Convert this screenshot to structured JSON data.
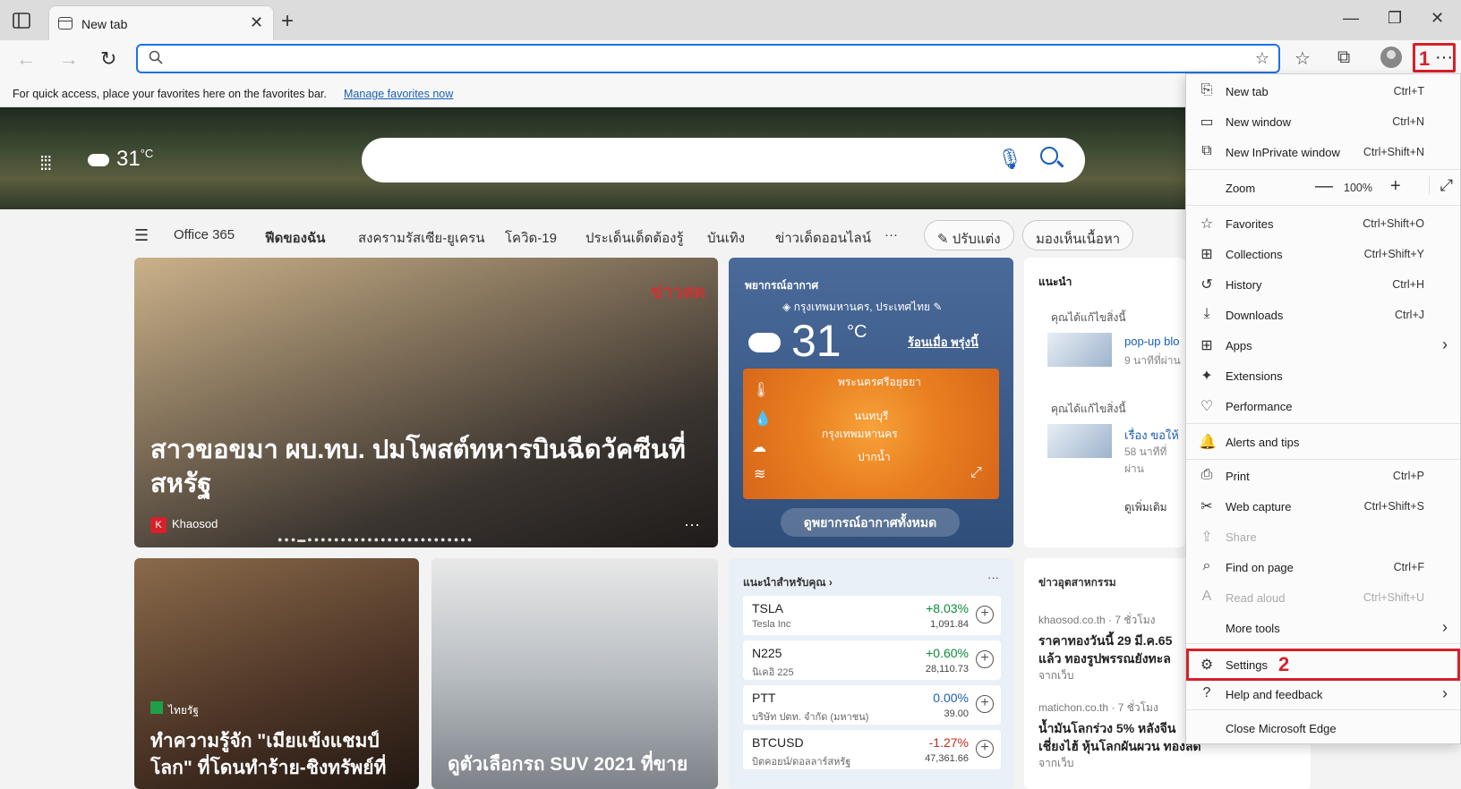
{
  "tab": {
    "title": "New tab"
  },
  "address": {
    "placeholder": ""
  },
  "favorites_bar": {
    "text": "For quick access, place your favorites here on the favorites bar.",
    "link": "Manage favorites now"
  },
  "hero": {
    "temp": "31",
    "unit": "°C"
  },
  "categories": [
    "Office 365",
    "ฟีดของฉัน",
    "สงครามรัสเซีย-ยูเครน",
    "โควิด-19",
    "ประเด็นเด็ดต้องรู้",
    "บันเทิง",
    "ข่าวเด็ดออนไลน์",
    "···"
  ],
  "pills": {
    "customize": "ปรับแต่ง",
    "visibility": "มองเห็นเนื้อหา"
  },
  "main_story": {
    "headline": "สาวขอขมา ผบ.ทบ. ปมโพสต์ทหารบินฉีดวัคซีนที่สหรัฐ",
    "source": "Khaosod",
    "source_badge": "K",
    "watermark": "ข่าวสด"
  },
  "weather": {
    "title": "พยากรณ์อากาศ",
    "location": "กรุงเทพมหานคร, ประเทศไทย",
    "temp": "31",
    "unit": "°C",
    "rain": "ร้อนเมื่อ พรุ่งนี้",
    "button": "ดูพยากรณ์อากาศทั้งหมด",
    "map_labels": [
      "พระนครศรีอยุธยา",
      "นนทบุรี",
      "กรุงเทพมหานคร",
      "ปากน้ำ"
    ]
  },
  "recommended": {
    "title": "แนะนำ",
    "items": [
      {
        "hint": "คุณได้แก้ไขสิ่งนี้",
        "title": "pop-up blo",
        "time": "9 นาทีที่ผ่าน"
      },
      {
        "hint": "คุณได้แก้ไขสิ่งนี้",
        "title": "เรื่อง ขอให้",
        "time": "58 นาทีที่ผ่าน"
      }
    ],
    "more": "ดูเพิ่มเติม"
  },
  "card2": {
    "source": "ไทยรัฐ",
    "headline": "ทำความรู้จัก \"เมียแข้งแชมป์โลก\" ที่โดนทำร้าย-ชิงทรัพย์ที่"
  },
  "card3": {
    "headline": "ดูตัวเลือกรถ SUV 2021 ที่ขาย"
  },
  "stocks": {
    "title": "แนะนำสำหรับคุณ",
    "rows": [
      {
        "symbol": "TSLA",
        "name": "Tesla Inc",
        "change": "+8.03%",
        "price": "1,091.84",
        "color": "#0b8a3a"
      },
      {
        "symbol": "N225",
        "name": "นิเคอิ 225",
        "change": "+0.60%",
        "price": "28,110.73",
        "color": "#0b8a3a"
      },
      {
        "symbol": "PTT",
        "name": "บริษัท ปตท. จำกัด (มหาชน)",
        "change": "0.00%",
        "price": "39.00",
        "color": "#1a5fb4"
      },
      {
        "symbol": "BTCUSD",
        "name": "บิตคอยน์/ดอลลาร์สหรัฐ",
        "change": "-1.27%",
        "price": "47,361.66",
        "color": "#c42b1c"
      }
    ]
  },
  "industry": {
    "title": "ข่าวอุตสาหกรรม",
    "items": [
      {
        "src": "khaosod.co.th · 7 ชั่วโมง",
        "line1": "ราคาทองวันนี้ 29 มี.ค.65",
        "line2": "แล้ว ทองรูปพรรณยังทะล",
        "from": "จากเว็บ"
      },
      {
        "src": "matichon.co.th · 7 ชั่วโมง",
        "line1": "น้ำมันโลกร่วง 5% หลังจีน",
        "line2": "เชี่ยงไฮ้ หุ้นโลกผันผวน ทองลด",
        "from": "จากเว็บ"
      }
    ]
  },
  "annotations": {
    "step1": "1",
    "step2": "2"
  },
  "menu": [
    {
      "icon": "⎘",
      "label": "New tab",
      "shortcut": "Ctrl+T"
    },
    {
      "icon": "▭",
      "label": "New window",
      "shortcut": "Ctrl+N"
    },
    {
      "icon": "⧉",
      "label": "New InPrivate window",
      "shortcut": "Ctrl+Shift+N"
    },
    {
      "label": "Zoom",
      "value": "100%"
    },
    {
      "icon": "☆",
      "label": "Favorites",
      "shortcut": "Ctrl+Shift+O"
    },
    {
      "icon": "⊞",
      "label": "Collections",
      "shortcut": "Ctrl+Shift+Y"
    },
    {
      "icon": "↺",
      "label": "History",
      "shortcut": "Ctrl+H"
    },
    {
      "icon": "⤓",
      "label": "Downloads",
      "shortcut": "Ctrl+J"
    },
    {
      "icon": "⊞",
      "label": "Apps",
      "chevron": "›"
    },
    {
      "icon": "✦",
      "label": "Extensions"
    },
    {
      "icon": "♡",
      "label": "Performance"
    },
    {
      "icon": "🔔",
      "label": "Alerts and tips"
    },
    {
      "icon": "⎙",
      "label": "Print",
      "shortcut": "Ctrl+P"
    },
    {
      "icon": "✂",
      "label": "Web capture",
      "shortcut": "Ctrl+Shift+S"
    },
    {
      "icon": "⇪",
      "label": "Share"
    },
    {
      "icon": "⌕",
      "label": "Find on page",
      "shortcut": "Ctrl+F"
    },
    {
      "icon": "A",
      "label": "Read aloud",
      "shortcut": "Ctrl+Shift+U"
    },
    {
      "label": "More tools",
      "chevron": "›"
    },
    {
      "icon": "⚙",
      "label": "Settings"
    },
    {
      "icon": "?",
      "label": "Help and feedback",
      "chevron": "›"
    },
    {
      "label": "Close Microsoft Edge"
    }
  ],
  "colors": {
    "accent": "#1a73e8",
    "annotation_red": "#d6202a"
  }
}
